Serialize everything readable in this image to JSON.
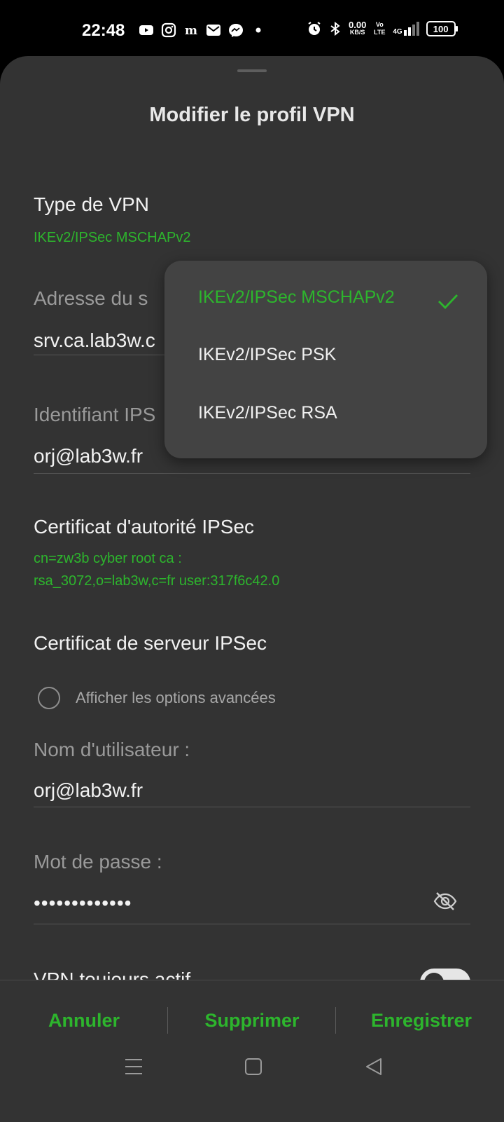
{
  "status_bar": {
    "time": "22:48",
    "left_icons": [
      "youtube-icon",
      "instagram-icon",
      "lemonde-icon",
      "mail-icon",
      "messenger-icon",
      "dot-icon"
    ],
    "right_icons": [
      "alarm-icon",
      "bluetooth-icon"
    ],
    "net_speed_value": "0.00",
    "net_speed_unit": "KB/S",
    "volte_label": "Vo LTE",
    "network_label": "4G",
    "battery": "100"
  },
  "sheet": {
    "title": "Modifier le profil VPN"
  },
  "fields": {
    "vpn_type_label": "Type de VPN",
    "vpn_type_value": "IKEv2/IPSec MSCHAPv2",
    "server_address_label": "Adresse du s",
    "server_address_value": "srv.ca.lab3w.c",
    "ipsec_id_label": "Identifiant IPS",
    "ipsec_id_value": "orj@lab3w.fr",
    "ca_cert_label": "Certificat d'autorité IPSec",
    "ca_cert_value_line1": "cn=zw3b cyber root ca :",
    "ca_cert_value_line2": "rsa_3072,o=lab3w,c=fr user:317f6c42.0",
    "server_cert_label": "Certificat de serveur IPSec",
    "advanced_options_label": "Afficher les options avancées",
    "username_label": "Nom d'utilisateur :",
    "username_value": "orj@lab3w.fr",
    "password_label": "Mot de passe :",
    "password_value": "•••••••••••••",
    "always_on_label": "VPN toujours actif"
  },
  "dropdown": {
    "items": [
      "IKEv2/IPSec MSCHAPv2",
      "IKEv2/IPSec PSK",
      "IKEv2/IPSec RSA"
    ],
    "selected_index": 0
  },
  "actions": {
    "cancel": "Annuler",
    "delete": "Supprimer",
    "save": "Enregistrer"
  },
  "nav_bar": {
    "icons": [
      "menu-icon",
      "home-icon",
      "back-icon"
    ]
  },
  "colors": {
    "accent": "#2db52d",
    "sheet_bg": "#333333",
    "dropdown_bg": "#434343"
  }
}
